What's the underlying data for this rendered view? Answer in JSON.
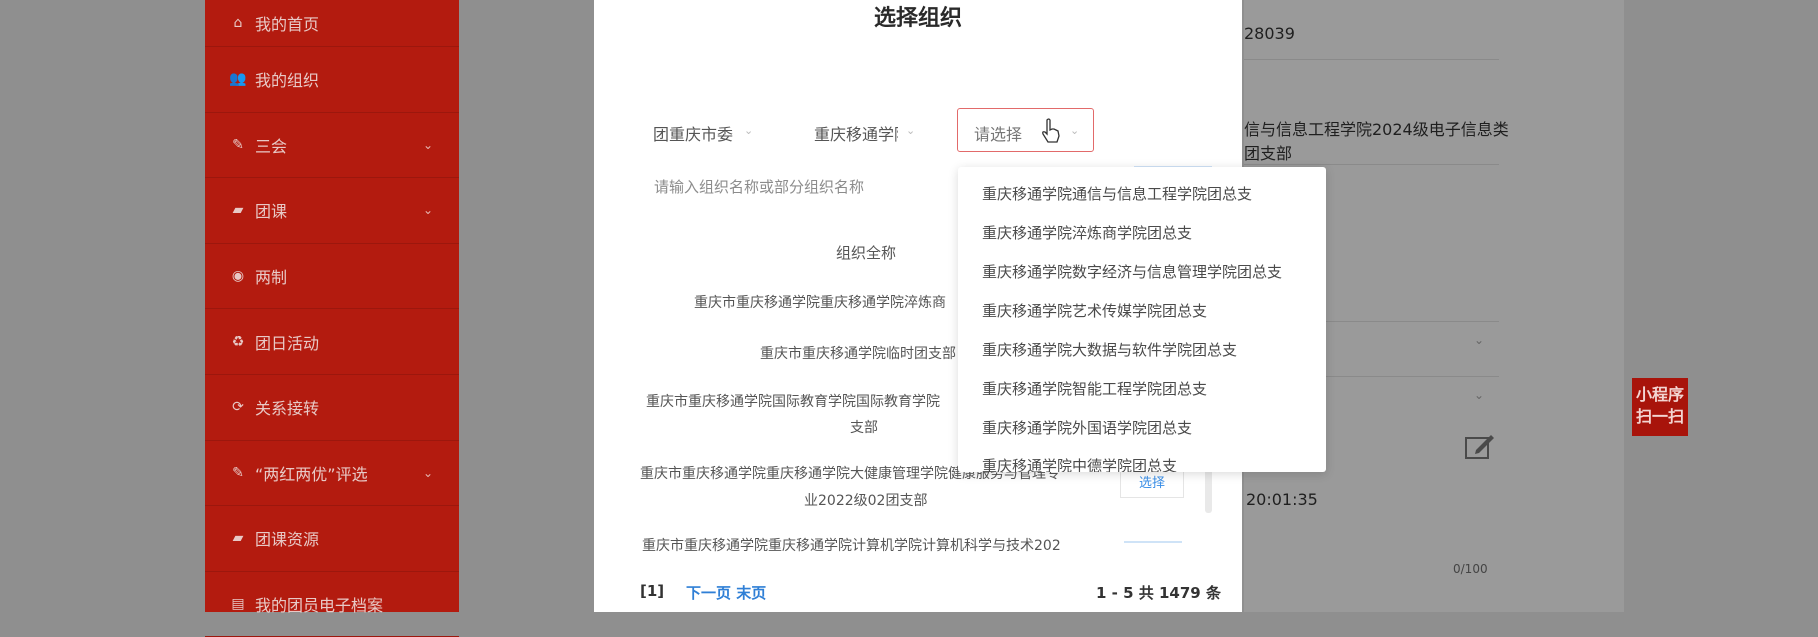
{
  "sidebar": {
    "items": [
      {
        "label": "我的首页",
        "icon": "home-icon",
        "glyph": "⌂",
        "chevron": false
      },
      {
        "label": "我的组织",
        "icon": "users-icon",
        "glyph": "👥",
        "chevron": false
      },
      {
        "label": "三会",
        "icon": "edit-icon",
        "glyph": "✎",
        "chevron": true
      },
      {
        "label": "团课",
        "icon": "folder-icon",
        "glyph": "▰",
        "chevron": true
      },
      {
        "label": "两制",
        "icon": "target-icon",
        "glyph": "◉",
        "chevron": false
      },
      {
        "label": "团日活动",
        "icon": "recycle-icon",
        "glyph": "♻",
        "chevron": false
      },
      {
        "label": "关系接转",
        "icon": "refresh-icon",
        "glyph": "⟳",
        "chevron": false
      },
      {
        "label": "“两红两优”评选",
        "icon": "edit-icon",
        "glyph": "✎",
        "chevron": true
      },
      {
        "label": "团课资源",
        "icon": "folder-icon",
        "glyph": "▰",
        "chevron": false
      },
      {
        "label": "我的团员电子档案",
        "icon": "file-icon",
        "glyph": "▤",
        "chevron": false
      }
    ],
    "chevron_glyph": "⌄"
  },
  "background": {
    "id_fragment": "28039",
    "org_line1": "信与信息工程学院2024级电子信息类",
    "org_line2": "团支部",
    "time": "20:01:35",
    "counter": "0/100",
    "mini_program": "小程序扫一扫"
  },
  "dialog": {
    "title": "选择组织",
    "selects": [
      "团重庆市委",
      "重庆移通学院",
      "请选择"
    ],
    "search_placeholder": "请输入组织名称或部分组织名称",
    "table_header": "组织全称",
    "rows": [
      "重庆市重庆移通学院重庆移通学院淬炼商",
      "重庆市重庆移通学院临时团支部",
      "重庆市重庆移通学院国际教育学院国际教育学院",
      "支部",
      "重庆市重庆移通学院重庆移通学院大健康管理学院健康服务与管理专",
      "业2022级02团支部",
      "重庆市重庆移通学院重庆移通学院计算机学院计算机科学与技术202"
    ],
    "select_button": "选择",
    "pager": {
      "current": "[1]",
      "next_last": "下一页 末页",
      "summary": "1 - 5   共 1479 条"
    }
  },
  "dropdown": {
    "options": [
      "重庆移通学院通信与信息工程学院团总支",
      "重庆移通学院淬炼商学院团总支",
      "重庆移通学院数字经济与信息管理学院团总支",
      "重庆移通学院艺术传媒学院团总支",
      "重庆移通学院大数据与软件学院团总支",
      "重庆移通学院智能工程学院团总支",
      "重庆移通学院外国语学院团总支",
      "重庆移通学院中德学院团总支"
    ]
  }
}
